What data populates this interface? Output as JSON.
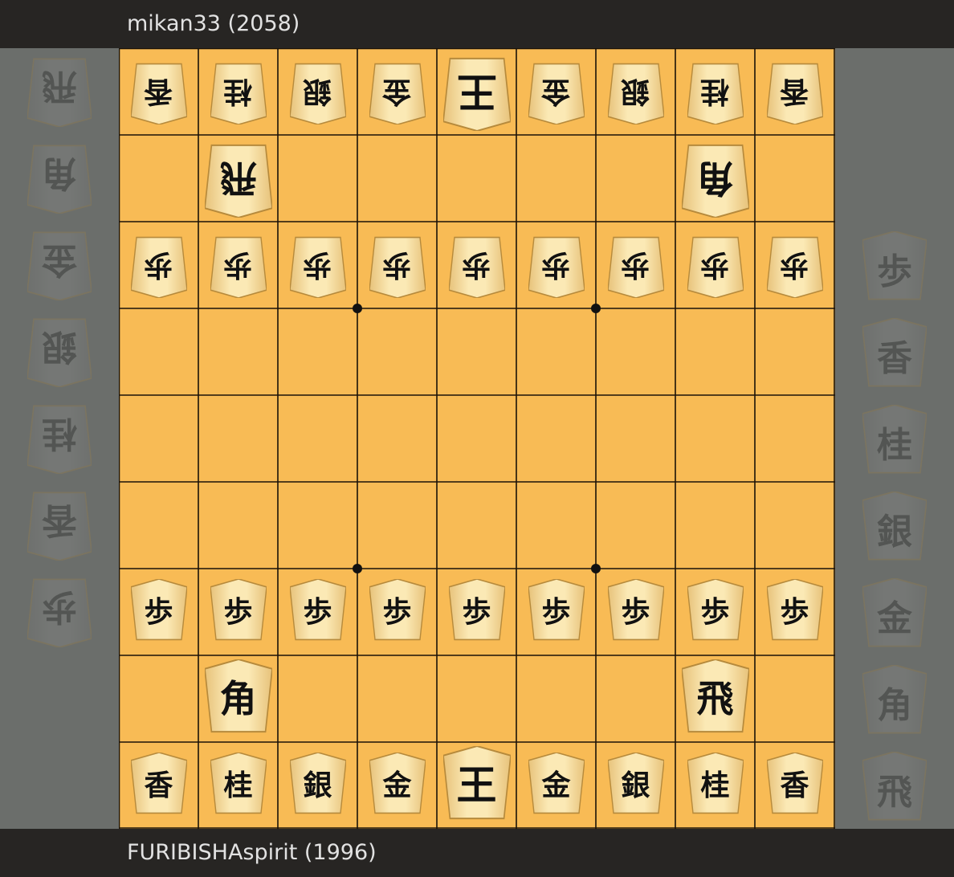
{
  "players": {
    "top": "mikan33 (2058)",
    "bottom": "FURIBISHAspirit (1996)"
  },
  "colors": {
    "board": "#f8bb55",
    "bar": "#272523",
    "background": "#6b6e6b",
    "piece_light": "#fbe9b5",
    "piece_dark": "#e7c27a"
  },
  "board": {
    "files": 9,
    "ranks": 9,
    "pieces": [
      {
        "file": 9,
        "rank": 1,
        "kanji": "香",
        "side": "gote"
      },
      {
        "file": 8,
        "rank": 1,
        "kanji": "桂",
        "side": "gote"
      },
      {
        "file": 7,
        "rank": 1,
        "kanji": "銀",
        "side": "gote"
      },
      {
        "file": 6,
        "rank": 1,
        "kanji": "金",
        "side": "gote"
      },
      {
        "file": 5,
        "rank": 1,
        "kanji": "王",
        "side": "gote"
      },
      {
        "file": 4,
        "rank": 1,
        "kanji": "金",
        "side": "gote"
      },
      {
        "file": 3,
        "rank": 1,
        "kanji": "銀",
        "side": "gote"
      },
      {
        "file": 2,
        "rank": 1,
        "kanji": "桂",
        "side": "gote"
      },
      {
        "file": 1,
        "rank": 1,
        "kanji": "香",
        "side": "gote"
      },
      {
        "file": 8,
        "rank": 2,
        "kanji": "飛",
        "side": "gote"
      },
      {
        "file": 2,
        "rank": 2,
        "kanji": "角",
        "side": "gote"
      },
      {
        "file": 9,
        "rank": 3,
        "kanji": "歩",
        "side": "gote"
      },
      {
        "file": 8,
        "rank": 3,
        "kanji": "歩",
        "side": "gote"
      },
      {
        "file": 7,
        "rank": 3,
        "kanji": "歩",
        "side": "gote"
      },
      {
        "file": 6,
        "rank": 3,
        "kanji": "歩",
        "side": "gote"
      },
      {
        "file": 5,
        "rank": 3,
        "kanji": "歩",
        "side": "gote"
      },
      {
        "file": 4,
        "rank": 3,
        "kanji": "歩",
        "side": "gote"
      },
      {
        "file": 3,
        "rank": 3,
        "kanji": "歩",
        "side": "gote"
      },
      {
        "file": 2,
        "rank": 3,
        "kanji": "歩",
        "side": "gote"
      },
      {
        "file": 1,
        "rank": 3,
        "kanji": "歩",
        "side": "gote"
      },
      {
        "file": 9,
        "rank": 7,
        "kanji": "歩",
        "side": "sente"
      },
      {
        "file": 8,
        "rank": 7,
        "kanji": "歩",
        "side": "sente"
      },
      {
        "file": 7,
        "rank": 7,
        "kanji": "歩",
        "side": "sente"
      },
      {
        "file": 6,
        "rank": 7,
        "kanji": "歩",
        "side": "sente"
      },
      {
        "file": 5,
        "rank": 7,
        "kanji": "歩",
        "side": "sente"
      },
      {
        "file": 4,
        "rank": 7,
        "kanji": "歩",
        "side": "sente"
      },
      {
        "file": 3,
        "rank": 7,
        "kanji": "歩",
        "side": "sente"
      },
      {
        "file": 2,
        "rank": 7,
        "kanji": "歩",
        "side": "sente"
      },
      {
        "file": 1,
        "rank": 7,
        "kanji": "歩",
        "side": "sente"
      },
      {
        "file": 8,
        "rank": 8,
        "kanji": "角",
        "side": "sente"
      },
      {
        "file": 2,
        "rank": 8,
        "kanji": "飛",
        "side": "sente"
      },
      {
        "file": 9,
        "rank": 9,
        "kanji": "香",
        "side": "sente"
      },
      {
        "file": 8,
        "rank": 9,
        "kanji": "桂",
        "side": "sente"
      },
      {
        "file": 7,
        "rank": 9,
        "kanji": "銀",
        "side": "sente"
      },
      {
        "file": 6,
        "rank": 9,
        "kanji": "金",
        "side": "sente"
      },
      {
        "file": 5,
        "rank": 9,
        "kanji": "王",
        "side": "sente"
      },
      {
        "file": 4,
        "rank": 9,
        "kanji": "金",
        "side": "sente"
      },
      {
        "file": 3,
        "rank": 9,
        "kanji": "銀",
        "side": "sente"
      },
      {
        "file": 2,
        "rank": 9,
        "kanji": "桂",
        "side": "sente"
      },
      {
        "file": 1,
        "rank": 9,
        "kanji": "香",
        "side": "sente"
      }
    ]
  },
  "hands": {
    "gote": [
      "飛",
      "角",
      "金",
      "銀",
      "桂",
      "香",
      "歩"
    ],
    "sente": [
      "歩",
      "香",
      "桂",
      "銀",
      "金",
      "角",
      "飛"
    ]
  }
}
